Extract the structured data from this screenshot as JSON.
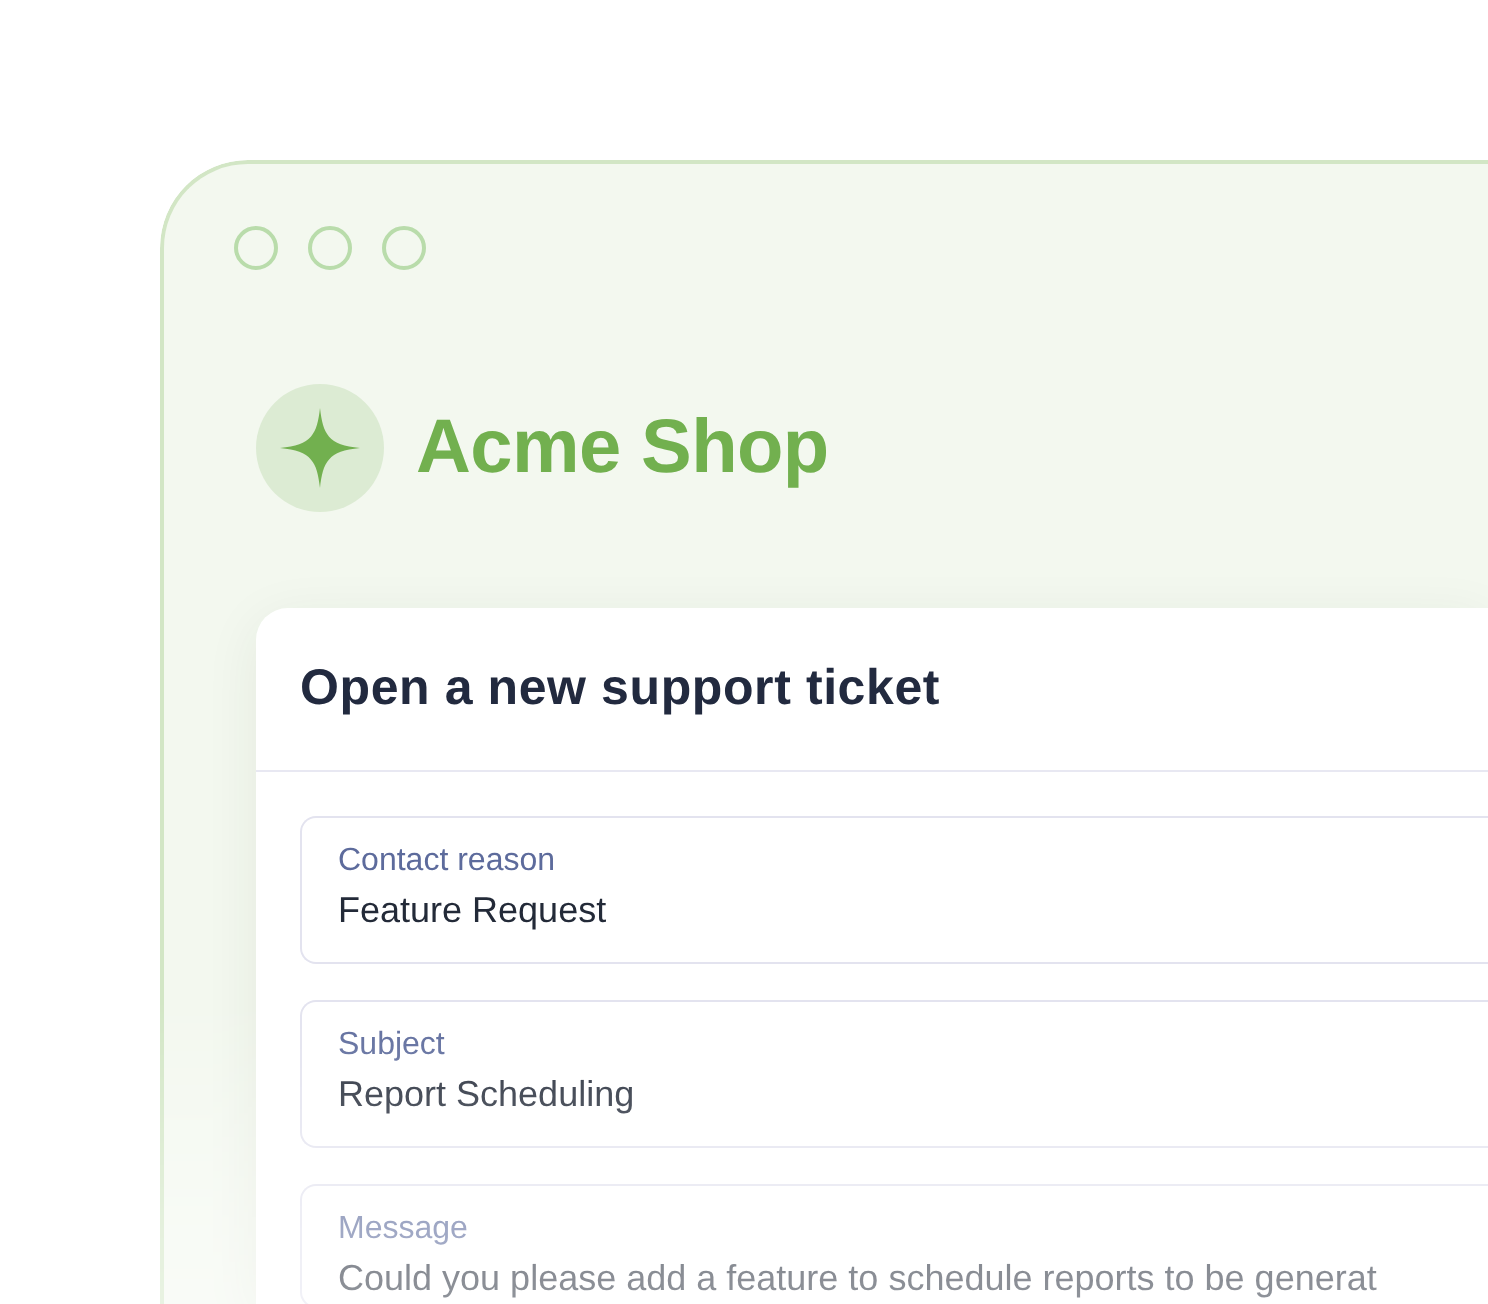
{
  "brand": {
    "name": "Acme Shop"
  },
  "form": {
    "title": "Open a new support ticket",
    "fields": [
      {
        "label": "Contact reason",
        "value": "Feature Request"
      },
      {
        "label": "Subject",
        "value": "Report Scheduling"
      },
      {
        "label": "Message",
        "value": "Could you please add a feature to schedule reports to be generat"
      }
    ]
  }
}
